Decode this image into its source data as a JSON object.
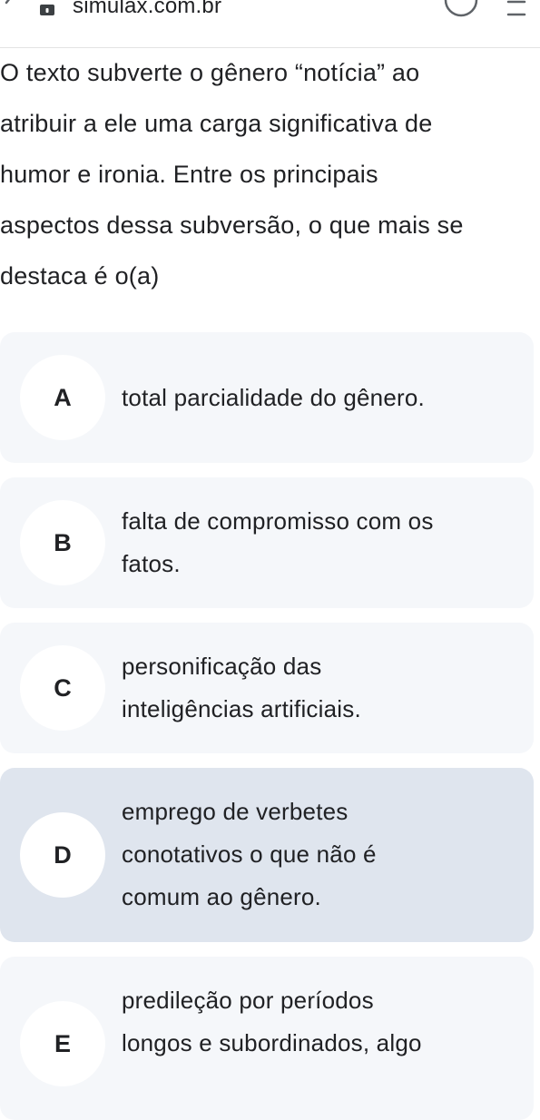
{
  "browser": {
    "url": "simulax.com.br"
  },
  "question": {
    "lines": [
      "O texto subverte o gênero “notícia” ao",
      "atribuir a ele uma carga significativa de",
      "humor e ironia. Entre os principais",
      "aspectos dessa subversão, o que mais se",
      "destaca é o(a)"
    ]
  },
  "options": [
    {
      "letter": "A",
      "lines": [
        "total parcialidade do gênero."
      ],
      "selected": false
    },
    {
      "letter": "B",
      "lines": [
        "falta de compromisso com os",
        "fatos."
      ],
      "selected": false
    },
    {
      "letter": "C",
      "lines": [
        "personificação das",
        "inteligências artificiais."
      ],
      "selected": false
    },
    {
      "letter": "D",
      "lines": [
        "emprego de verbetes",
        "conotativos o que não é",
        "comum ao gênero."
      ],
      "selected": true
    },
    {
      "letter": "E",
      "lines": [
        "predileção por períodos",
        "longos e subordinados, algo"
      ],
      "selected": false
    }
  ],
  "colors": {
    "option_bg": "#f5f7fa",
    "option_selected_bg": "#dfe5ee",
    "letter_circle": "#ffffff",
    "text": "#202124"
  }
}
